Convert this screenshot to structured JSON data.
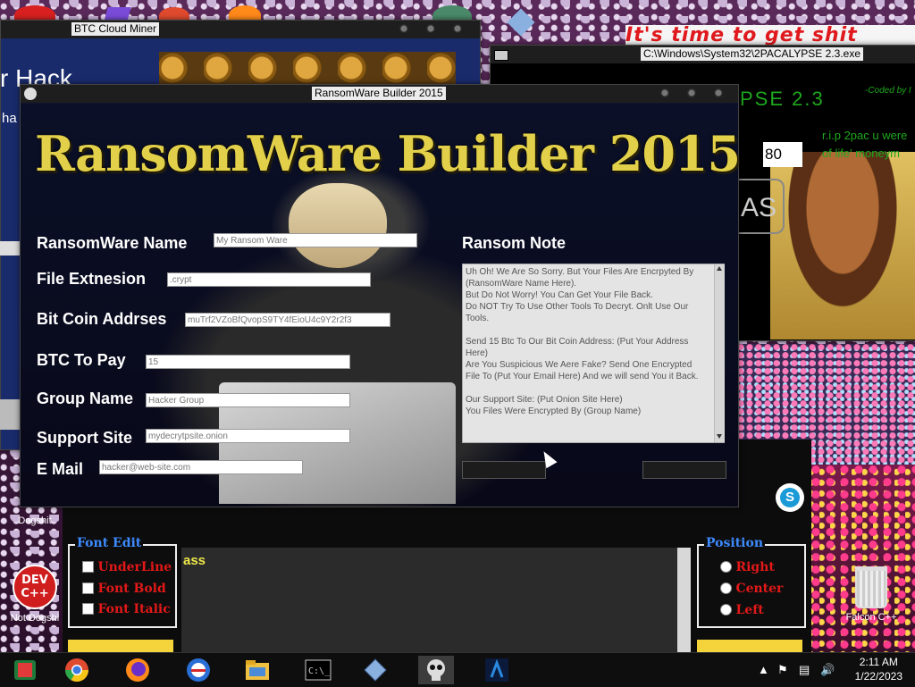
{
  "background": {
    "banner_text": "It's time to get shit"
  },
  "desktop_icons": {
    "dogshit_label": "Dogshit",
    "devcpp_line1": "DEV",
    "devcpp_line2": "C++",
    "not_dogshit_label": "Not Dogshi",
    "recycle_label": "Falcon C++"
  },
  "btc_window": {
    "title": "BTC Cloud Miner",
    "hack_text": "r Hack",
    "ha_text": "ha"
  },
  "cmd_window": {
    "title": "C:\\Windows\\System32\\2PACALYPSE 2.3.exe",
    "app_title_partial": "PSE  2.3",
    "coded_by": "-Coded by I",
    "rip_line1": "r.i.p 2pac u were",
    "rip_line2": "of life' moneym",
    "number_field": "80",
    "as_button": "AS"
  },
  "ransomware_window": {
    "title": "RansomWare Builder 2015",
    "logo_text": "RansomWare Builder 2015",
    "fields": [
      {
        "label": "RansomWare Name",
        "value": "My Ransom Ware"
      },
      {
        "label": "File Extnesion",
        "value": ".crypt"
      },
      {
        "label": "Bit Coin Addrses",
        "value": "muTrf2VZoBfQvopS9TY4fEioU4c9Y2r2f3"
      },
      {
        "label": "BTC To Pay",
        "value": "15"
      },
      {
        "label": "Group Name",
        "value": "Hacker Group"
      },
      {
        "label": "Support Site",
        "value": "mydecrytpsite.onion"
      },
      {
        "label": "E Mail",
        "value": "hacker@web-site.com"
      }
    ],
    "note_label": "Ransom Note",
    "note_text": "Uh Oh! We Are So Sorry. But Your Files Are Encrpyted By (RansomWare Name Here).\nBut Do Not Worry! You Can Get Your File Back.\nDo NOT Try To Use Other Tools To Decryt. Onlt Use Our Tools.\n\nSend 15 Btc To Our Bit Coin Address: (Put Your Address Here)\nAre You Suspicious We Aere Fake? Send One Encrypted File To (Put Your Email Here) And we will send You it Back.\n\nOur Support Site: (Put Onion Site Here)\nYou Files Were Encrypted By (Group Name)"
  },
  "font_window": {
    "font_edit_title": "Font Edit",
    "font_options": [
      "UnderLine",
      "Font Bold",
      "Font Italic"
    ],
    "position_title": "Position",
    "position_options": [
      "Right",
      "Center",
      "Left"
    ],
    "editor_text": "ass"
  },
  "taskbar": {
    "time": "2:11 AM",
    "date": "1/22/2023"
  },
  "colors": {
    "logo_gold": "#e3d04a",
    "option_red": "#e31818",
    "group_blue": "#3d8bff",
    "console_green": "#1ea81e"
  }
}
